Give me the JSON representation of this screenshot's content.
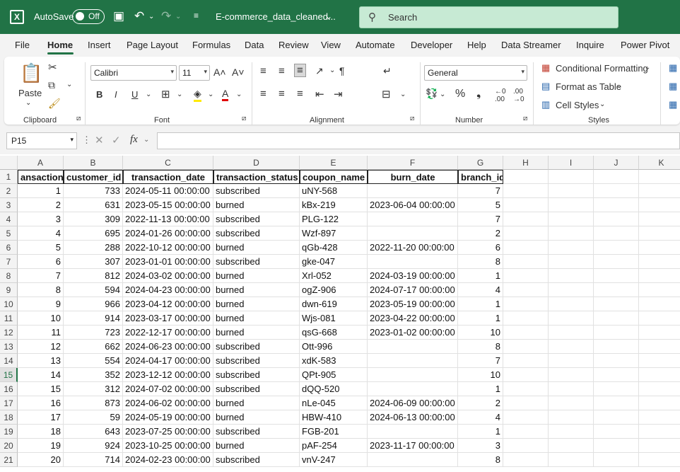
{
  "titlebar": {
    "autosave_label": "AutoSave",
    "toggle_label": "Off",
    "filename": "E-commerce_data_cleaned...",
    "search_placeholder": "Search"
  },
  "menu": [
    "File",
    "Home",
    "Insert",
    "Page Layout",
    "Formulas",
    "Data",
    "Review",
    "View",
    "Automate",
    "Developer",
    "Help",
    "Data Streamer",
    "Inquire",
    "Power Pivot"
  ],
  "ribbon": {
    "clipboard": {
      "paste": "Paste",
      "label": "Clipboard"
    },
    "font": {
      "name": "Calibri",
      "size": "11",
      "label": "Font"
    },
    "alignment": {
      "label": "Alignment"
    },
    "number": {
      "format": "General",
      "label": "Number"
    },
    "styles": {
      "conditional": "Conditional Formatting",
      "table": "Format as Table",
      "cell": "Cell Styles",
      "label": "Styles"
    }
  },
  "formula_bar": {
    "namebox": "P15",
    "fx": "fx",
    "value": ""
  },
  "grid": {
    "columns": [
      "A",
      "B",
      "C",
      "D",
      "E",
      "F",
      "G",
      "H",
      "I",
      "J",
      "K"
    ],
    "headers": [
      "ansaction_",
      "customer_id",
      "transaction_date",
      "transaction_status",
      "coupon_name",
      "burn_date",
      "branch_id"
    ],
    "selected_row": "15",
    "rows": [
      [
        "1",
        "733",
        "2024-05-11 00:00:00",
        "subscribed",
        "uNY-568",
        "",
        "7"
      ],
      [
        "2",
        "631",
        "2023-05-15 00:00:00",
        "burned",
        "kBx-219",
        "2023-06-04 00:00:00",
        "5"
      ],
      [
        "3",
        "309",
        "2022-11-13 00:00:00",
        "subscribed",
        "PLG-122",
        "",
        "7"
      ],
      [
        "4",
        "695",
        "2024-01-26 00:00:00",
        "subscribed",
        "Wzf-897",
        "",
        "2"
      ],
      [
        "5",
        "288",
        "2022-10-12 00:00:00",
        "burned",
        "qGb-428",
        "2022-11-20 00:00:00",
        "6"
      ],
      [
        "6",
        "307",
        "2023-01-01 00:00:00",
        "subscribed",
        "gke-047",
        "",
        "8"
      ],
      [
        "7",
        "812",
        "2024-03-02 00:00:00",
        "burned",
        "Xrl-052",
        "2024-03-19 00:00:00",
        "1"
      ],
      [
        "8",
        "594",
        "2024-04-23 00:00:00",
        "burned",
        "ogZ-906",
        "2024-07-17 00:00:00",
        "4"
      ],
      [
        "9",
        "966",
        "2023-04-12 00:00:00",
        "burned",
        "dwn-619",
        "2023-05-19 00:00:00",
        "1"
      ],
      [
        "10",
        "914",
        "2023-03-17 00:00:00",
        "burned",
        "Wjs-081",
        "2023-04-22 00:00:00",
        "1"
      ],
      [
        "11",
        "723",
        "2022-12-17 00:00:00",
        "burned",
        "qsG-668",
        "2023-01-02 00:00:00",
        "10"
      ],
      [
        "12",
        "662",
        "2024-06-23 00:00:00",
        "subscribed",
        "Ott-996",
        "",
        "8"
      ],
      [
        "13",
        "554",
        "2024-04-17 00:00:00",
        "subscribed",
        "xdK-583",
        "",
        "7"
      ],
      [
        "14",
        "352",
        "2023-12-12 00:00:00",
        "subscribed",
        "QPt-905",
        "",
        "10"
      ],
      [
        "15",
        "312",
        "2024-07-02 00:00:00",
        "subscribed",
        "dQQ-520",
        "",
        "1"
      ],
      [
        "16",
        "873",
        "2024-06-02 00:00:00",
        "burned",
        "nLe-045",
        "2024-06-09 00:00:00",
        "2"
      ],
      [
        "17",
        "59",
        "2024-05-19 00:00:00",
        "burned",
        "HBW-410",
        "2024-06-13 00:00:00",
        "4"
      ],
      [
        "18",
        "643",
        "2023-07-25 00:00:00",
        "subscribed",
        "FGB-201",
        "",
        "1"
      ],
      [
        "19",
        "924",
        "2023-10-25 00:00:00",
        "burned",
        "pAF-254",
        "2023-11-17 00:00:00",
        "3"
      ],
      [
        "20",
        "714",
        "2024-02-23 00:00:00",
        "subscribed",
        "vnV-247",
        "",
        "8"
      ]
    ]
  }
}
